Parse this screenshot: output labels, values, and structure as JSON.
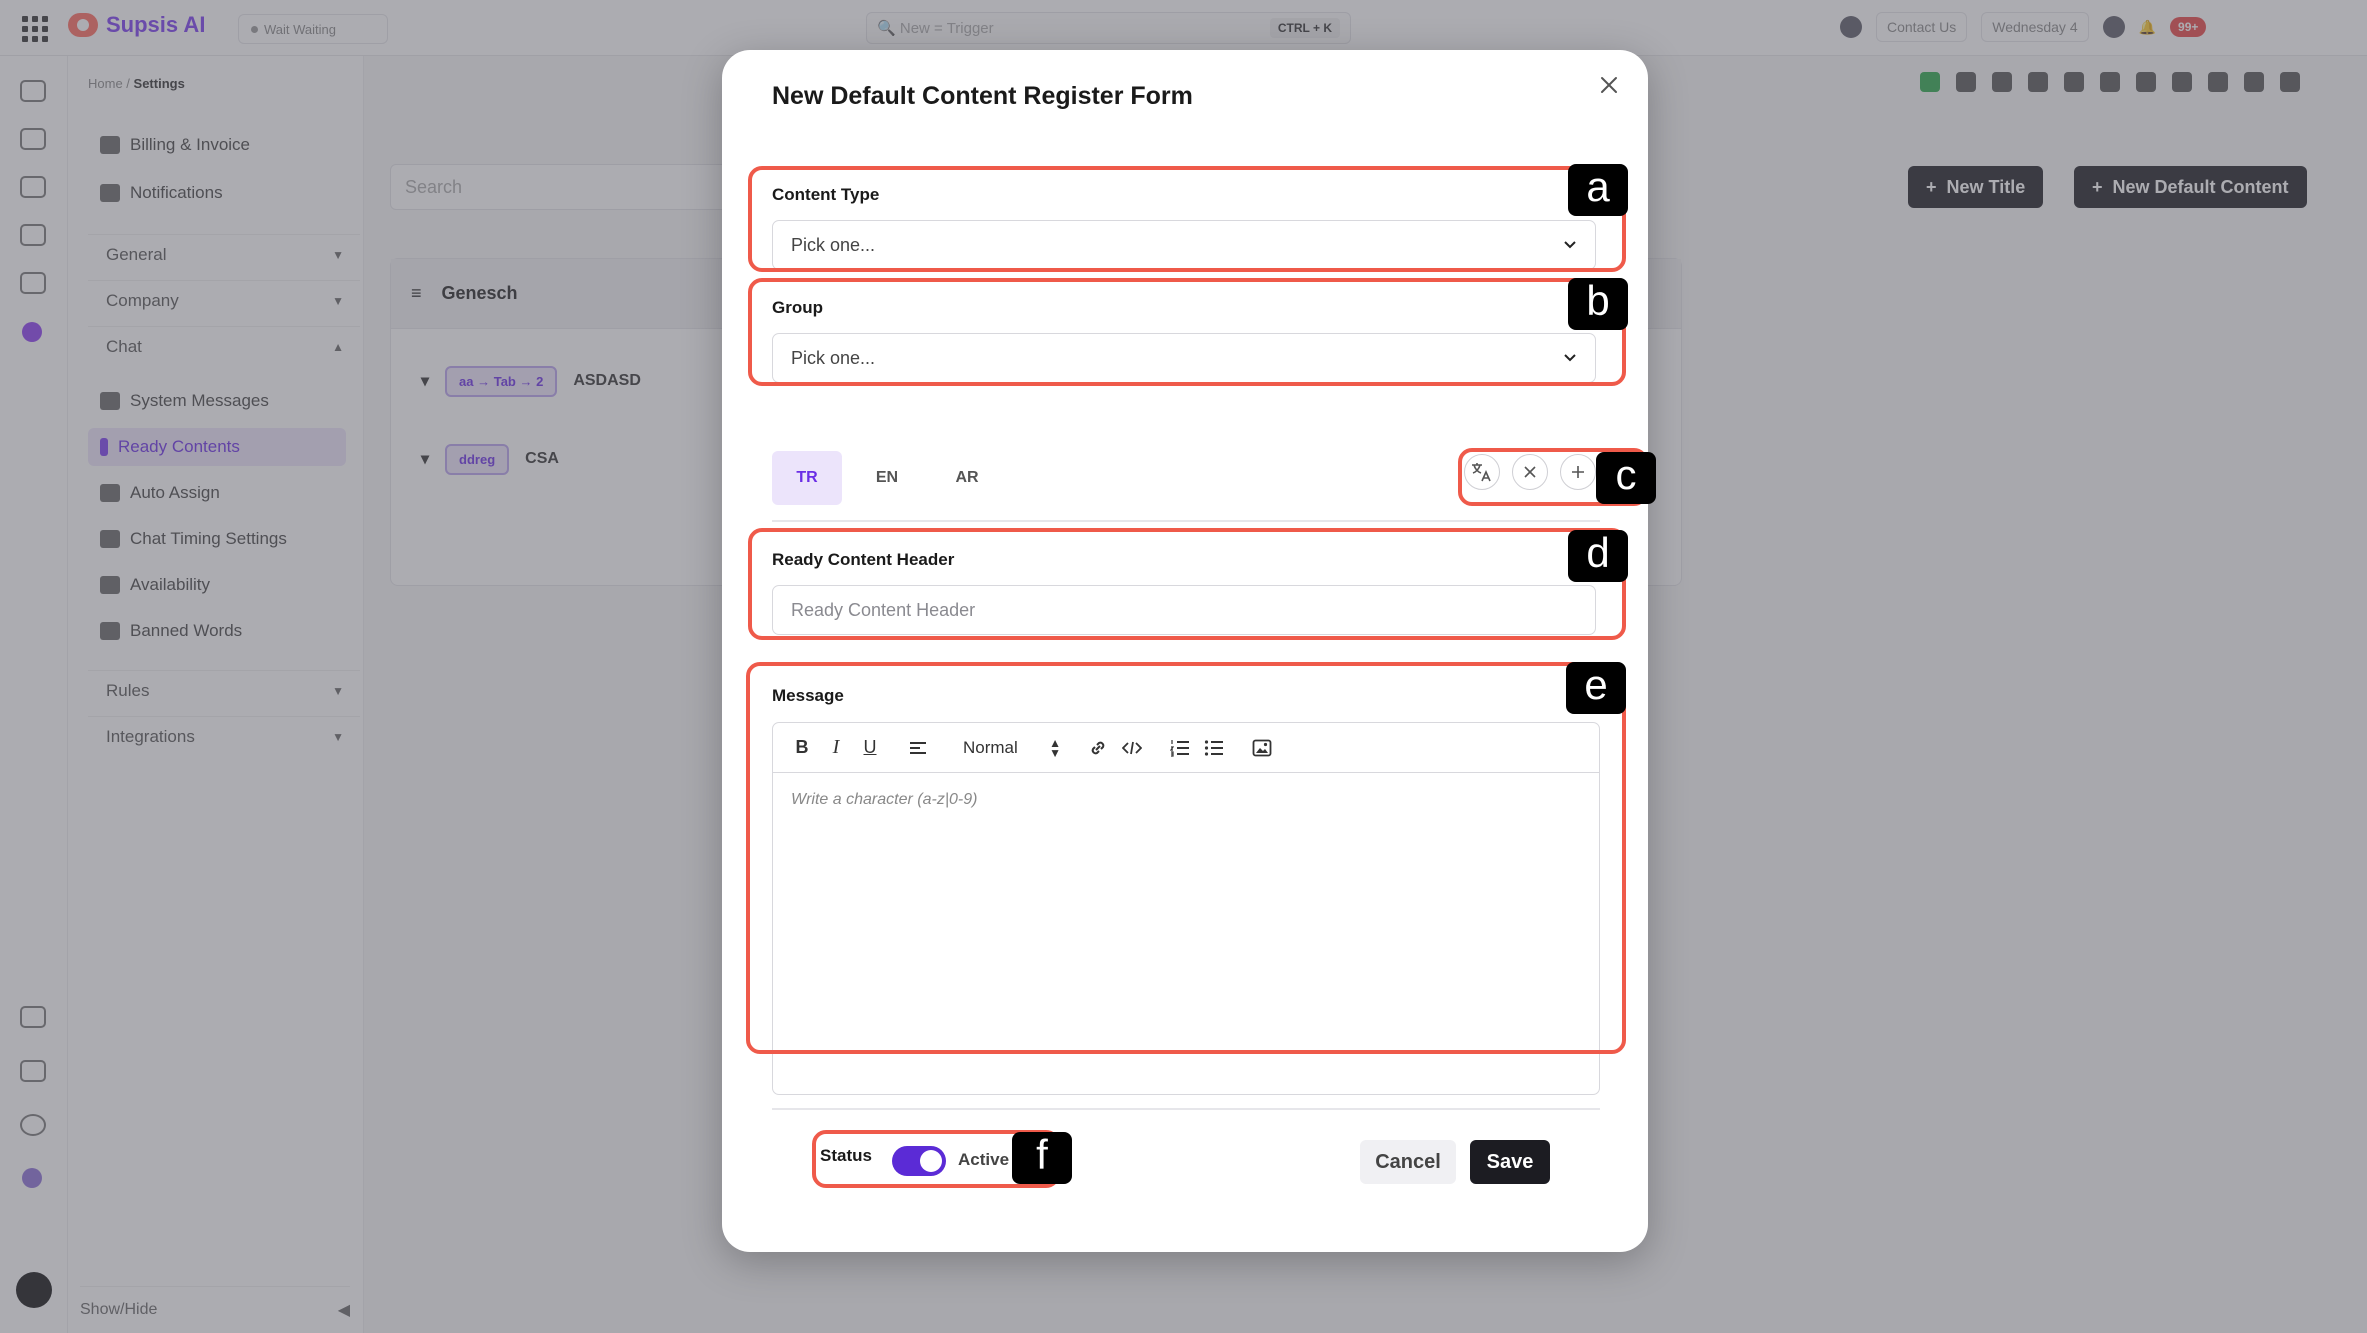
{
  "background": {
    "logo_text": "Supsis AI",
    "bot_status": "Wait Waiting",
    "search_placeholder": "New = Trigger",
    "search_shortcut": "CTRL + K",
    "contact_us": "Contact Us",
    "date_pill": "Wednesday 4",
    "notif_badge": "99+",
    "breadcrumb_home": "Home /",
    "breadcrumb_current": "Settings",
    "sidebar_top_items": [
      "Billing & Invoice",
      "Notifications"
    ],
    "sidebar_groups": [
      "General",
      "Company",
      "Chat"
    ],
    "chat_items": [
      "System Messages",
      "Ready Contents",
      "Auto Assign",
      "Chat Timing Settings",
      "Availability",
      "Banned Words"
    ],
    "active_item": "Ready Contents",
    "sidebar_groups_bottom": [
      "Rules",
      "Integrations"
    ],
    "show_hide": "Show/Hide",
    "content_search_placeholder": "Search",
    "new_title_button": "New Title",
    "new_default_content_button": "New Default Content",
    "group_name": "Genesch",
    "rows": [
      {
        "tag": "aa → Tab → 2",
        "name": "ASDASD"
      },
      {
        "tag": "ddreg",
        "name": "CSA"
      }
    ]
  },
  "modal": {
    "title": "New Default Content Register Form",
    "content_type": {
      "label": "Content Type",
      "value": "Pick one..."
    },
    "group": {
      "label": "Group",
      "value": "Pick one..."
    },
    "lang_tabs": [
      "TR",
      "EN",
      "AR"
    ],
    "active_lang": "TR",
    "header_field": {
      "label": "Ready Content Header",
      "placeholder": "Ready Content Header"
    },
    "message": {
      "label": "Message",
      "heading_select": "Normal",
      "placeholder": "Write a character (a-z|0-9)"
    },
    "status": {
      "label": "Status",
      "value": "Active",
      "on": true
    },
    "cancel": "Cancel",
    "save": "Save"
  },
  "annotations": [
    "a",
    "b",
    "c",
    "d",
    "e",
    "f"
  ],
  "colors": {
    "accent": "#5b2bd6",
    "highlight": "#ef5a4a",
    "dark": "#1c1c22"
  }
}
